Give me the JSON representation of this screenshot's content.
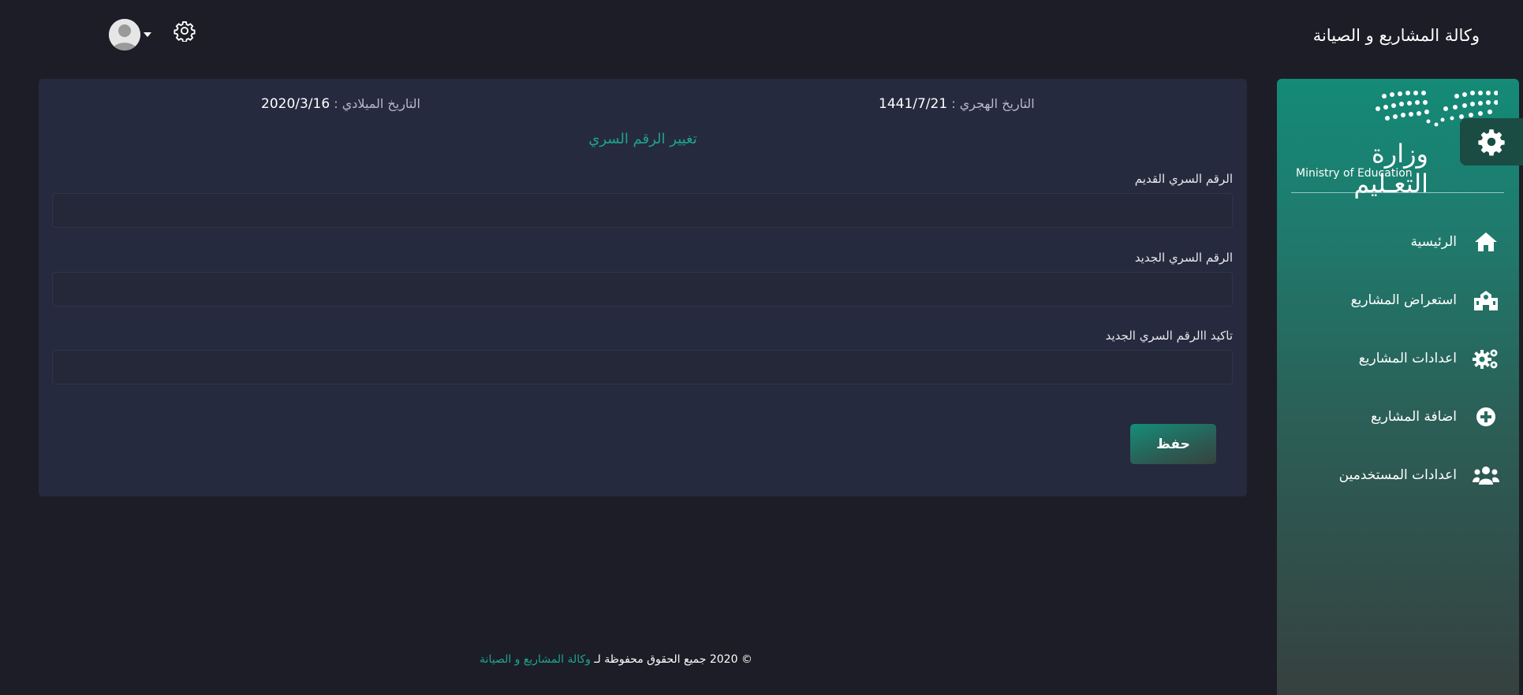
{
  "header": {
    "brand": "وكالة المشاريع و الصيانة",
    "user_icon": "avatar-icon",
    "settings_icon": "gear-icon"
  },
  "sidebar": {
    "logo": {
      "arabic": "وزارة التعـليم",
      "english": "Ministry of Education"
    },
    "items": [
      {
        "label": "الرئيسية",
        "icon": "home-icon"
      },
      {
        "label": "استعراض المشاريع",
        "icon": "school-icon"
      },
      {
        "label": "اعدادات المشاريع",
        "icon": "cogs-icon"
      },
      {
        "label": "اضافة المشاريع",
        "icon": "plus-circle-icon"
      },
      {
        "label": "اعدادات المستخدمين",
        "icon": "users-icon"
      }
    ]
  },
  "main": {
    "hijri_label": "التاريخ الهجري :",
    "hijri_value": "1441/7/21",
    "gregorian_label": "التاريخ الميلادي :",
    "gregorian_value": "2020/3/16",
    "form_title": "تغيير الرقم السري",
    "fields": [
      {
        "label": "الرقم السري القديم",
        "value": "",
        "placeholder": ""
      },
      {
        "label": "الرقم السري الجديد",
        "value": "",
        "placeholder": ""
      },
      {
        "label": "تاكيد االرقم السري الجديد",
        "value": "",
        "placeholder": ""
      }
    ],
    "save_label": "حفظ"
  },
  "footer": {
    "text": "© 2020 جميع الحقوق محفوظة لـ",
    "link": "وكالة المشاريع و الصيانة"
  },
  "colors": {
    "accent": "#1da58e",
    "background": "#1d1d27",
    "card": "#262a3e"
  }
}
